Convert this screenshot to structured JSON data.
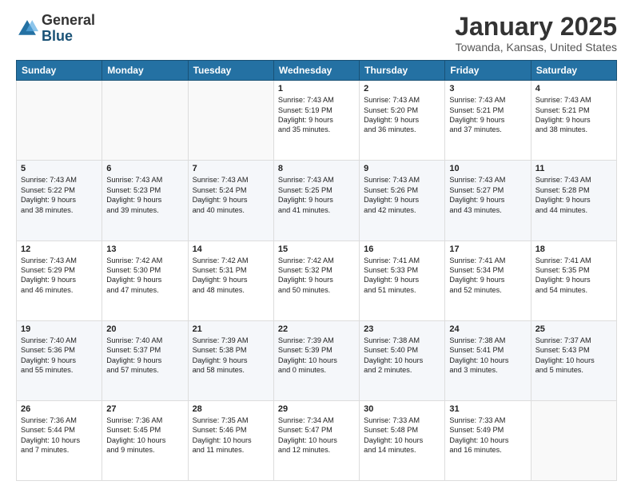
{
  "header": {
    "logo": {
      "general": "General",
      "blue": "Blue"
    },
    "title": "January 2025",
    "subtitle": "Towanda, Kansas, United States"
  },
  "days_of_week": [
    "Sunday",
    "Monday",
    "Tuesday",
    "Wednesday",
    "Thursday",
    "Friday",
    "Saturday"
  ],
  "weeks": [
    [
      {
        "day": "",
        "info": ""
      },
      {
        "day": "",
        "info": ""
      },
      {
        "day": "",
        "info": ""
      },
      {
        "day": "1",
        "info": "Sunrise: 7:43 AM\nSunset: 5:19 PM\nDaylight: 9 hours\nand 35 minutes."
      },
      {
        "day": "2",
        "info": "Sunrise: 7:43 AM\nSunset: 5:20 PM\nDaylight: 9 hours\nand 36 minutes."
      },
      {
        "day": "3",
        "info": "Sunrise: 7:43 AM\nSunset: 5:21 PM\nDaylight: 9 hours\nand 37 minutes."
      },
      {
        "day": "4",
        "info": "Sunrise: 7:43 AM\nSunset: 5:21 PM\nDaylight: 9 hours\nand 38 minutes."
      }
    ],
    [
      {
        "day": "5",
        "info": "Sunrise: 7:43 AM\nSunset: 5:22 PM\nDaylight: 9 hours\nand 38 minutes."
      },
      {
        "day": "6",
        "info": "Sunrise: 7:43 AM\nSunset: 5:23 PM\nDaylight: 9 hours\nand 39 minutes."
      },
      {
        "day": "7",
        "info": "Sunrise: 7:43 AM\nSunset: 5:24 PM\nDaylight: 9 hours\nand 40 minutes."
      },
      {
        "day": "8",
        "info": "Sunrise: 7:43 AM\nSunset: 5:25 PM\nDaylight: 9 hours\nand 41 minutes."
      },
      {
        "day": "9",
        "info": "Sunrise: 7:43 AM\nSunset: 5:26 PM\nDaylight: 9 hours\nand 42 minutes."
      },
      {
        "day": "10",
        "info": "Sunrise: 7:43 AM\nSunset: 5:27 PM\nDaylight: 9 hours\nand 43 minutes."
      },
      {
        "day": "11",
        "info": "Sunrise: 7:43 AM\nSunset: 5:28 PM\nDaylight: 9 hours\nand 44 minutes."
      }
    ],
    [
      {
        "day": "12",
        "info": "Sunrise: 7:43 AM\nSunset: 5:29 PM\nDaylight: 9 hours\nand 46 minutes."
      },
      {
        "day": "13",
        "info": "Sunrise: 7:42 AM\nSunset: 5:30 PM\nDaylight: 9 hours\nand 47 minutes."
      },
      {
        "day": "14",
        "info": "Sunrise: 7:42 AM\nSunset: 5:31 PM\nDaylight: 9 hours\nand 48 minutes."
      },
      {
        "day": "15",
        "info": "Sunrise: 7:42 AM\nSunset: 5:32 PM\nDaylight: 9 hours\nand 50 minutes."
      },
      {
        "day": "16",
        "info": "Sunrise: 7:41 AM\nSunset: 5:33 PM\nDaylight: 9 hours\nand 51 minutes."
      },
      {
        "day": "17",
        "info": "Sunrise: 7:41 AM\nSunset: 5:34 PM\nDaylight: 9 hours\nand 52 minutes."
      },
      {
        "day": "18",
        "info": "Sunrise: 7:41 AM\nSunset: 5:35 PM\nDaylight: 9 hours\nand 54 minutes."
      }
    ],
    [
      {
        "day": "19",
        "info": "Sunrise: 7:40 AM\nSunset: 5:36 PM\nDaylight: 9 hours\nand 55 minutes."
      },
      {
        "day": "20",
        "info": "Sunrise: 7:40 AM\nSunset: 5:37 PM\nDaylight: 9 hours\nand 57 minutes."
      },
      {
        "day": "21",
        "info": "Sunrise: 7:39 AM\nSunset: 5:38 PM\nDaylight: 9 hours\nand 58 minutes."
      },
      {
        "day": "22",
        "info": "Sunrise: 7:39 AM\nSunset: 5:39 PM\nDaylight: 10 hours\nand 0 minutes."
      },
      {
        "day": "23",
        "info": "Sunrise: 7:38 AM\nSunset: 5:40 PM\nDaylight: 10 hours\nand 2 minutes."
      },
      {
        "day": "24",
        "info": "Sunrise: 7:38 AM\nSunset: 5:41 PM\nDaylight: 10 hours\nand 3 minutes."
      },
      {
        "day": "25",
        "info": "Sunrise: 7:37 AM\nSunset: 5:43 PM\nDaylight: 10 hours\nand 5 minutes."
      }
    ],
    [
      {
        "day": "26",
        "info": "Sunrise: 7:36 AM\nSunset: 5:44 PM\nDaylight: 10 hours\nand 7 minutes."
      },
      {
        "day": "27",
        "info": "Sunrise: 7:36 AM\nSunset: 5:45 PM\nDaylight: 10 hours\nand 9 minutes."
      },
      {
        "day": "28",
        "info": "Sunrise: 7:35 AM\nSunset: 5:46 PM\nDaylight: 10 hours\nand 11 minutes."
      },
      {
        "day": "29",
        "info": "Sunrise: 7:34 AM\nSunset: 5:47 PM\nDaylight: 10 hours\nand 12 minutes."
      },
      {
        "day": "30",
        "info": "Sunrise: 7:33 AM\nSunset: 5:48 PM\nDaylight: 10 hours\nand 14 minutes."
      },
      {
        "day": "31",
        "info": "Sunrise: 7:33 AM\nSunset: 5:49 PM\nDaylight: 10 hours\nand 16 minutes."
      },
      {
        "day": "",
        "info": ""
      }
    ]
  ]
}
